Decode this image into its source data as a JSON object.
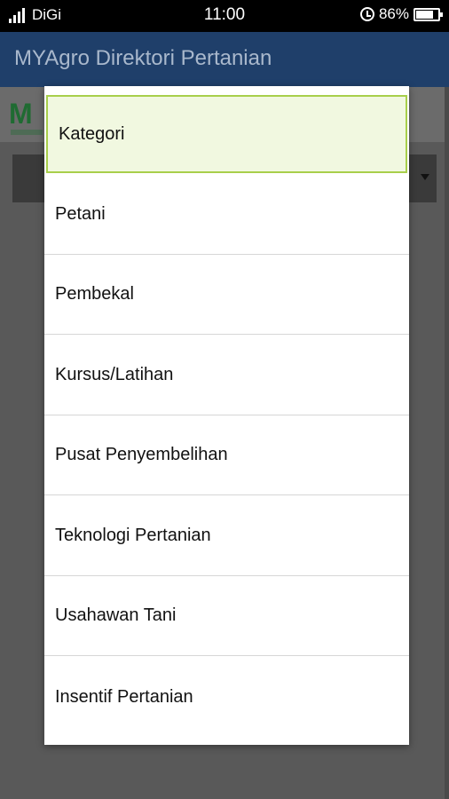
{
  "status_bar": {
    "carrier": "DiGi",
    "time": "11:00",
    "battery": "86%"
  },
  "app_bar": {
    "title": "MYAgro Direktori Pertanian"
  },
  "background": {
    "logo_text": "M"
  },
  "dialog": {
    "options": [
      {
        "label": "Kategori",
        "selected": true
      },
      {
        "label": "Petani"
      },
      {
        "label": "Pembekal"
      },
      {
        "label": "Kursus/Latihan"
      },
      {
        "label": "Pusat Penyembelihan"
      },
      {
        "label": "Teknologi Pertanian"
      },
      {
        "label": "Usahawan Tani"
      },
      {
        "label": "Insentif Pertanian"
      }
    ]
  },
  "colors": {
    "selected_border": "#a8cf4b",
    "selected_fill": "#f1f8e0",
    "app_bar": "#1f3f6a"
  }
}
